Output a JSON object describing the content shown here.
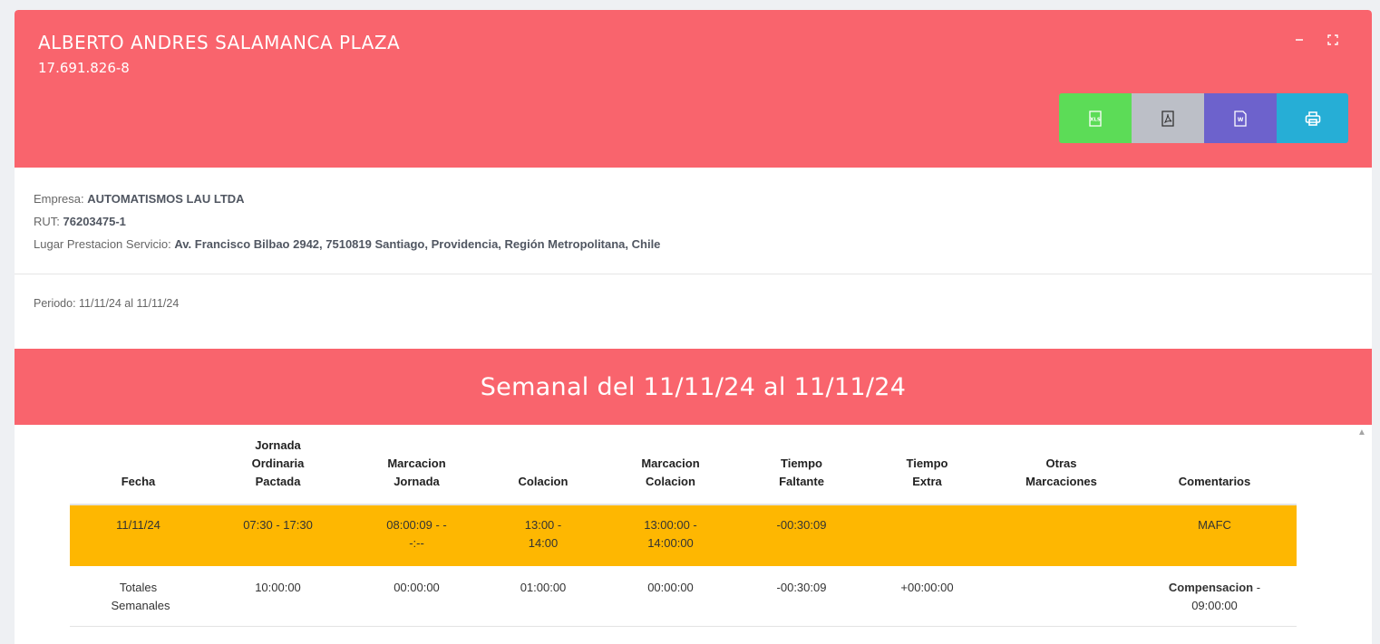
{
  "employee": {
    "name": "ALBERTO ANDRES SALAMANCA PLAZA",
    "rut": "17.691.826-8"
  },
  "window_controls": [
    "minimize-icon",
    "fullscreen-icon"
  ],
  "export_buttons": [
    {
      "icon": "xls-icon",
      "color": "#5cdc57"
    },
    {
      "icon": "pdf-icon",
      "color": "#bcbfc7"
    },
    {
      "icon": "word-icon",
      "color": "#6d62cc"
    },
    {
      "icon": "print-icon",
      "color": "#26aed6"
    }
  ],
  "company": {
    "empresa_label": "Empresa: ",
    "empresa": "AUTOMATISMOS LAU LTDA",
    "rut_label": "RUT: ",
    "rut": "76203475-1",
    "lugar_label": "Lugar Prestacion Servicio: ",
    "lugar": "Av. Francisco Bilbao 2942, 7510819 Santiago, Providencia, Región Metropolitana, Chile"
  },
  "periodo": "Periodo: 11/11/24 al 11/11/24",
  "week_title": "Semanal del 11/11/24 al 11/11/24",
  "colors": {
    "accent": "#f9646d",
    "warning_row": "#feb701"
  },
  "table": {
    "headers": [
      "Fecha",
      "Jornada Ordinaria Pactada",
      "Marcacion Jornada",
      "Colacion",
      "Marcacion Colacion",
      "Tiempo Faltante",
      "Tiempo Extra",
      "Otras Marcaciones",
      "Comentarios"
    ],
    "rows": [
      [
        "11/11/24",
        "07:30 - 17:30",
        "08:00:09 - - -:--",
        "13:00 - 14:00",
        "13:00:00 - 14:00:00",
        "-00:30:09",
        "",
        "",
        "MAFC"
      ]
    ],
    "totals": {
      "label": "Totales Semanales",
      "values": [
        "10:00:00",
        "00:00:00",
        "01:00:00",
        "00:00:00",
        "-00:30:09",
        "+00:00:00",
        ""
      ],
      "comment_bold": "Compensacion",
      "comment_rest": " - 09:00:00"
    }
  }
}
